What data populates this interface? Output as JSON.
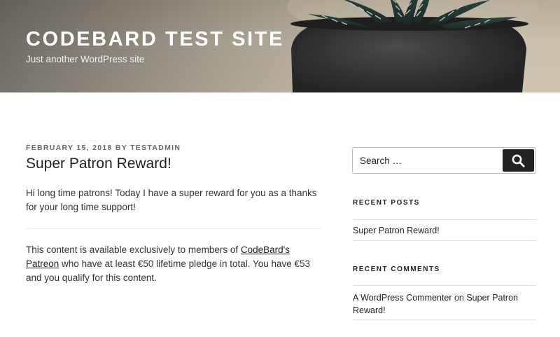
{
  "header": {
    "site_title": "CODEBARD TEST SITE",
    "tagline": "Just another WordPress site"
  },
  "post": {
    "date": "FEBRUARY 15, 2018",
    "by": "BY",
    "author": "TESTADMIN",
    "title": "Super Patron Reward!",
    "paragraph1": "Hi long time patrons! Today I have a super reward for you as a thanks for your long time support!",
    "paragraph2_before_link": "This content is available exclusively to members of ",
    "paragraph2_link": "CodeBard's Patreon",
    "paragraph2_after_link": " who have at least €50 lifetime pledge in total. You have €53 and you qualify for this content."
  },
  "sidebar": {
    "search": {
      "placeholder": "Search …",
      "button_icon": "search-icon"
    },
    "recent_posts": {
      "title": "RECENT POSTS",
      "items": [
        "Super Patron Reward!"
      ]
    },
    "recent_comments": {
      "title": "RECENT COMMENTS",
      "commenter": "A WordPress Commenter",
      "on": " on ",
      "post": "Super Patron Reward!"
    }
  },
  "colors": {
    "text": "#222222",
    "meta": "#666666",
    "search_button": "#222222",
    "divider": "#dddddd"
  }
}
